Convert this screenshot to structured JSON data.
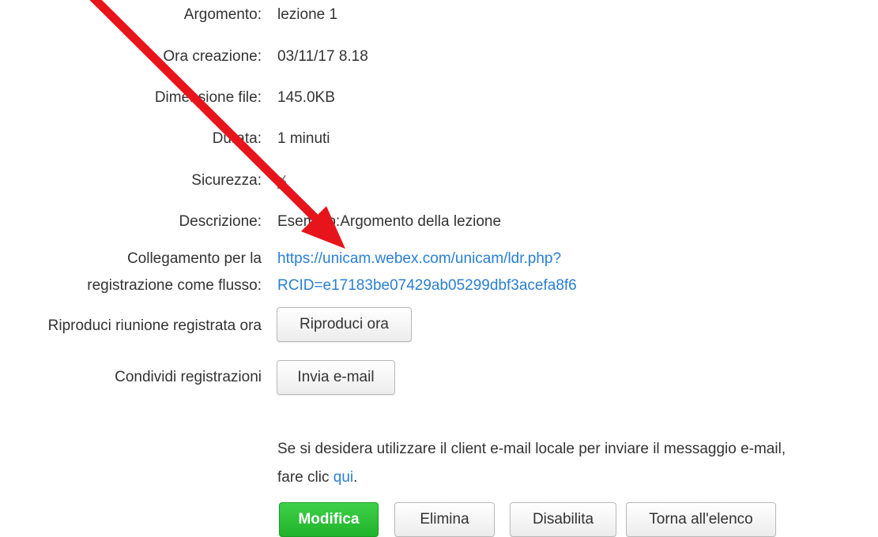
{
  "details": {
    "topic_label": "Argomento:",
    "topic_value": "lezione 1",
    "created_label": "Ora creazione:",
    "created_value": "03/11/17 8.18",
    "filesize_label": "Dimensione file:",
    "filesize_value": "145.0KB",
    "duration_label": "Durata:",
    "duration_value": "1 minuti",
    "security_label": "Sicurezza:",
    "description_label": "Descrizione:",
    "description_value": "Esempio:Argomento della lezione",
    "stream_label_line1": "Collegamento per la",
    "stream_label_line2": "registrazione come flusso:",
    "stream_link_line1": "https://unicam.webex.com/unicam/ldr.php?",
    "stream_link_line2": "RCID=e17183be07429ab05299dbf3acefa8f6"
  },
  "actions": {
    "play_label": "Riproduci riunione registrata ora",
    "play_button": "Riproduci ora",
    "share_label": "Condividi registrazioni",
    "share_button": "Invia e-mail",
    "note_text": "Se si desidera utilizzare il client e-mail locale per inviare il messaggio e-mail,",
    "note_text2": "fare clic ",
    "note_link": "qui",
    "note_end": "."
  },
  "footer_buttons": {
    "edit": "Modifica",
    "delete": "Elimina",
    "disable": "Disabilita",
    "back": "Torna all'elenco"
  },
  "icons": {
    "security": "lock-icon",
    "annotation": "red-arrow"
  },
  "colors": {
    "link": "#2a7fd4",
    "primary_button": "#24b92f",
    "annotation_arrow": "#e8141c"
  }
}
